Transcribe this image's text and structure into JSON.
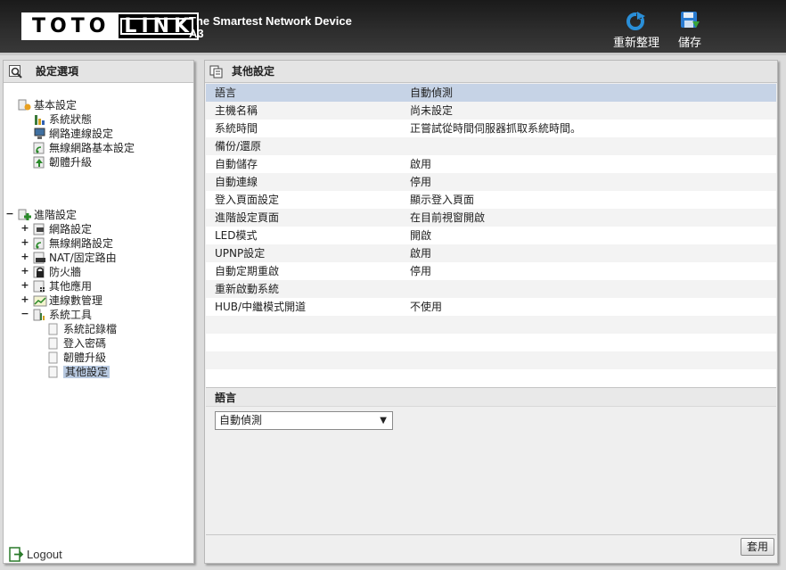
{
  "header": {
    "brand_left": "TOTO",
    "brand_right": "LINK",
    "tagline_line1": "The Smartest Network Device",
    "tagline_line2": "A3",
    "rearrange_label": "重新整理",
    "save_label": "儲存"
  },
  "left_panel": {
    "title": "設定選項",
    "basic": {
      "label": "基本設定",
      "items": [
        "系統狀態",
        "網路連線設定",
        "無線網路基本設定",
        "韌體升級"
      ]
    },
    "advanced": {
      "label": "進階設定",
      "expander": "−",
      "items": [
        {
          "expander": "+",
          "label": "網路設定"
        },
        {
          "expander": "+",
          "label": "無線網路設定"
        },
        {
          "expander": "+",
          "label": "NAT/固定路由"
        },
        {
          "expander": "+",
          "label": "防火牆"
        },
        {
          "expander": "+",
          "label": "其他應用"
        },
        {
          "expander": "+",
          "label": "連線數管理"
        },
        {
          "expander": "−",
          "label": "系統工具"
        }
      ],
      "system_tools_items": [
        "系統記錄檔",
        "登入密碼",
        "韌體升級",
        "其他設定"
      ]
    },
    "logout_label": "Logout"
  },
  "right_panel": {
    "title": "其他設定",
    "rows": [
      {
        "key": "語言",
        "value": "自動偵測"
      },
      {
        "key": "主機名稱",
        "value": "尚未設定"
      },
      {
        "key": "系統時間",
        "value": "正嘗試從時間伺服器抓取系統時間。"
      },
      {
        "key": "備份/還原",
        "value": ""
      },
      {
        "key": "自動儲存",
        "value": "啟用"
      },
      {
        "key": "自動連線",
        "value": "停用"
      },
      {
        "key": "登入頁面設定",
        "value": "顯示登入頁面"
      },
      {
        "key": "進階設定頁面",
        "value": "在目前視窗開啟"
      },
      {
        "key": "LED模式",
        "value": "開啟"
      },
      {
        "key": "UPNP設定",
        "value": "啟用"
      },
      {
        "key": "自動定期重啟",
        "value": "停用"
      },
      {
        "key": "重新啟動系統",
        "value": ""
      },
      {
        "key": "HUB/中繼模式開道",
        "value": "不使用"
      },
      {
        "key": "",
        "value": ""
      },
      {
        "key": "",
        "value": ""
      },
      {
        "key": "",
        "value": ""
      },
      {
        "key": "",
        "value": ""
      }
    ],
    "sub_section_title": "語言",
    "language_select_value": "自動偵測",
    "apply_label": "套用"
  },
  "colors": {
    "header_bg": "#222222",
    "selected_row": "#c6d3e6",
    "selected_tree": "#b8c9e0"
  }
}
